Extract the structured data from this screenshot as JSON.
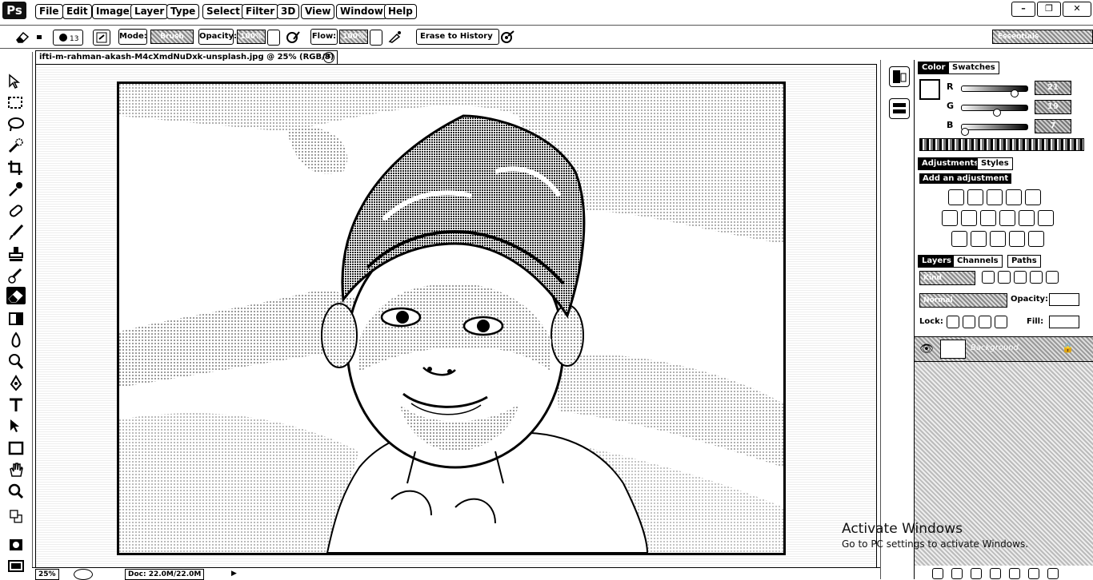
{
  "app": {
    "logo": "Ps"
  },
  "menu": [
    "File",
    "Edit",
    "Image",
    "Layer",
    "Type",
    "Select",
    "Filter",
    "3D",
    "View",
    "Window",
    "Help"
  ],
  "options_bar": {
    "mode_label": "Mode:",
    "mode_value": "Brush",
    "opacity_label": "Opacity:",
    "opacity_value": "100%",
    "flow_label": "Flow:",
    "flow_value": "100%",
    "erase_to_history": "Erase to History",
    "workspace_value": "Essentials"
  },
  "document": {
    "tab_title": "ifti-m-rahman-akash-M4cXmdNuDxk-unsplash.jpg @ 25% (RGB/8)",
    "zoom": "25%",
    "doc_size": "Doc: 22.0M/22.0M"
  },
  "panels": {
    "color_tab": "Color",
    "swatches_tab": "Swatches",
    "r_label": "R",
    "g_label": "G",
    "b_label": "B",
    "r_value": "21",
    "g_value": "19",
    "b_value": "7",
    "adjustments_tab": "Adjustments",
    "styles_tab": "Styles",
    "add_adjustment": "Add an adjustment",
    "layers_tab": "Layers",
    "channels_tab": "Channels",
    "paths_tab": "Paths",
    "kind_filter": "Kind",
    "blend_mode": "Normal",
    "opacity_label": "Opacity:",
    "lock_label": "Lock:",
    "fill_label": "Fill:",
    "layer_name": "Background"
  },
  "activation": {
    "title": "Activate Windows",
    "subtitle": "Go to PC settings to activate Windows."
  },
  "colors": {
    "chrome": "#ffffff",
    "ink": "#000000"
  }
}
